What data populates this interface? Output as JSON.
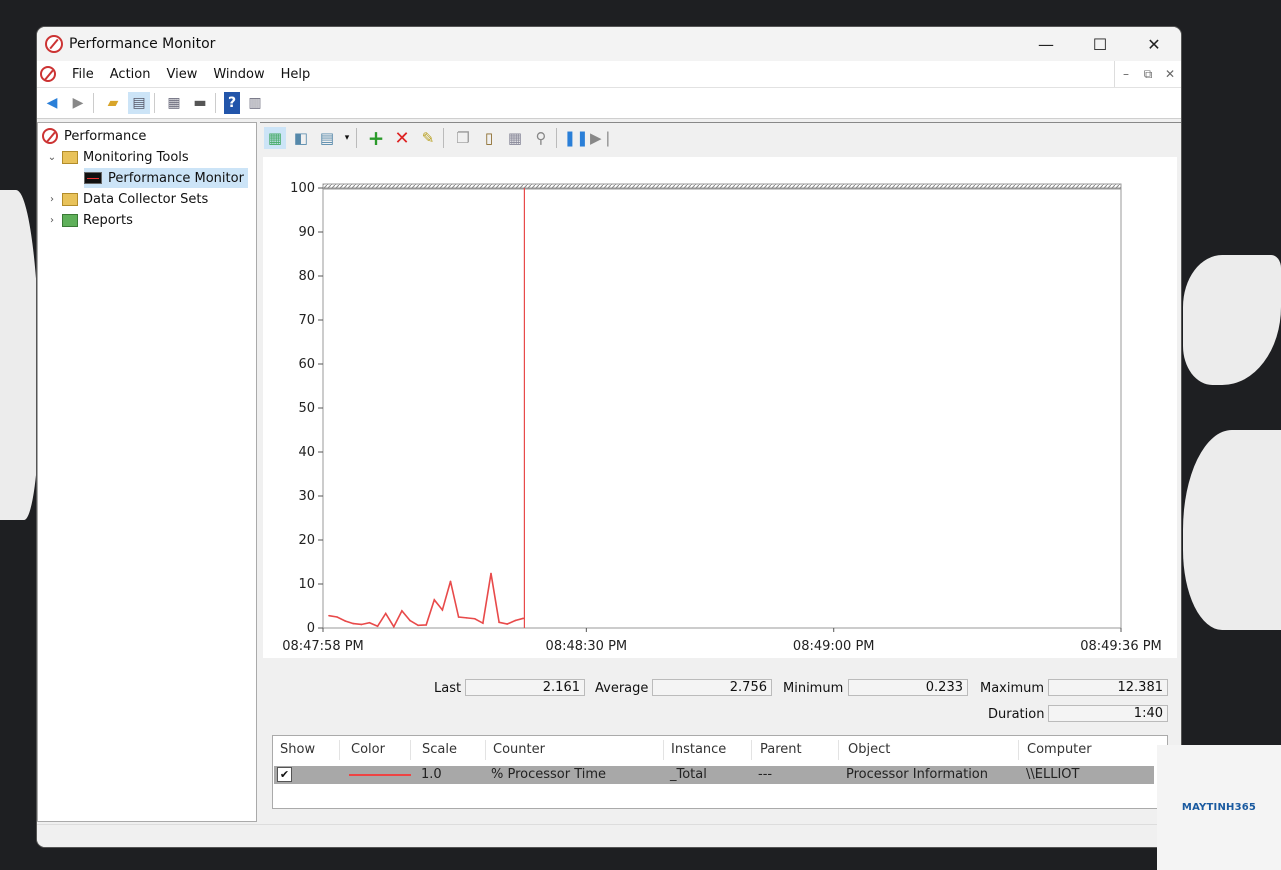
{
  "window": {
    "title": "Performance Monitor",
    "controls": [
      "—",
      "☐",
      "✕"
    ]
  },
  "menubar": {
    "items": [
      "File",
      "Action",
      "View",
      "Window",
      "Help"
    ],
    "mdi_controls": [
      "–",
      "⧉",
      "✕"
    ]
  },
  "tree": {
    "root": "Performance",
    "monitoring_tools": "Monitoring Tools",
    "performance_monitor": "Performance Monitor",
    "data_collector_sets": "Data Collector Sets",
    "reports": "Reports"
  },
  "chart_data": {
    "type": "line",
    "ylim": [
      0,
      100
    ],
    "yticks": [
      0,
      10,
      20,
      30,
      40,
      50,
      60,
      70,
      80,
      90,
      100
    ],
    "xticks": [
      "08:47:58 PM",
      "08:48:30 PM",
      "08:49:00 PM",
      "08:49:36 PM"
    ],
    "series": [
      {
        "color": "#e84a4a",
        "values": [
          2.8,
          2.5,
          1.6,
          1.0,
          0.8,
          1.2,
          0.4,
          3.3,
          0.3,
          3.9,
          1.7,
          0.6,
          0.7,
          6.4,
          4.1,
          10.6,
          2.5,
          2.3,
          2.1,
          1.1,
          12.4,
          1.3,
          0.9,
          1.7,
          2.2
        ]
      }
    ]
  },
  "stats": {
    "last_label": "Last",
    "last": "2.161",
    "average_label": "Average",
    "average": "2.756",
    "minimum_label": "Minimum",
    "minimum": "0.233",
    "maximum_label": "Maximum",
    "maximum": "12.381",
    "duration_label": "Duration",
    "duration": "1:40"
  },
  "counter_table": {
    "headers": [
      "Show",
      "Color",
      "Scale",
      "Counter",
      "Instance",
      "Parent",
      "Object",
      "Computer"
    ],
    "row": {
      "show": "✔",
      "scale": "1.0",
      "counter": "% Processor Time",
      "instance": "_Total",
      "parent": "---",
      "object": "Processor Information",
      "computer": "\\\\ELLIOT"
    }
  },
  "watermark": {
    "text": "MAYTINH365"
  }
}
